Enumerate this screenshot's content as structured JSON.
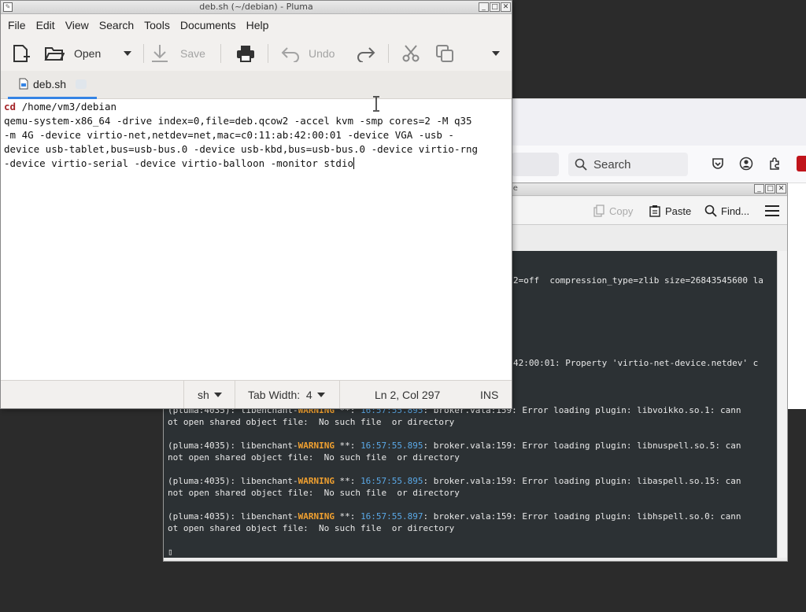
{
  "pluma": {
    "window_title": "deb.sh (~/debian) - Pluma",
    "menu": [
      "File",
      "Edit",
      "View",
      "Search",
      "Tools",
      "Documents",
      "Help"
    ],
    "toolbar": {
      "open_label": "Open",
      "save_label": "Save",
      "undo_label": "Undo"
    },
    "tab": {
      "label": "deb.sh"
    },
    "editor": {
      "line1_keyword": "cd",
      "line1_rest": " /home/vm3/debian",
      "wrapped_lines": [
        "qemu-system-x86_64 -drive index=0,file=deb.qcow2 -accel kvm -smp cores=2 -M q35",
        "-m 4G -device virtio-net,netdev=net,mac=c0:11:ab:42:00:01 -device VGA -usb -",
        "device usb-tablet,bus=usb-bus.0 -device usb-kbd,bus=usb-bus.0 -device virtio-rng",
        "-device virtio-serial -device virtio-balloon -monitor stdio"
      ]
    },
    "status": {
      "language": "sh",
      "tab_width": "Tab Width:  4",
      "position": "Ln 2, Col 297",
      "mode": "INS"
    }
  },
  "browser": {
    "search_placeholder": "Search"
  },
  "terminal": {
    "title_fragment": "le",
    "toolbar": {
      "copy": "Copy",
      "paste": "Paste",
      "find": "Find..."
    },
    "lines_upper": [
      "2=off  compression_type=zlib size=26843545600 la",
      "42:00:01: Property 'virtio-net-device.netdev' c"
    ],
    "warnings": [
      {
        "prefix": "(pluma:4035): libenchant-",
        "level": "WARNING",
        "mid": " **: ",
        "time": "16:57:55.895",
        "msg": ": broker.vala:159: Error loading plugin: libvoikko.so.1: cann",
        "cont": "ot open shared object file:  No such file  or directory"
      },
      {
        "prefix": "(pluma:4035): libenchant-",
        "level": "WARNING",
        "mid": " **: ",
        "time": "16:57:55.895",
        "msg": ": broker.vala:159: Error loading plugin: libnuspell.so.5: can",
        "cont": "not open shared object file:  No such file  or directory"
      },
      {
        "prefix": "(pluma:4035): libenchant-",
        "level": "WARNING",
        "mid": " **: ",
        "time": "16:57:55.895",
        "msg": ": broker.vala:159: Error loading plugin: libaspell.so.15: can",
        "cont": "not open shared object file:  No such file  or directory"
      },
      {
        "prefix": "(pluma:4035): libenchant-",
        "level": "WARNING",
        "mid": " **: ",
        "time": "16:57:55.897",
        "msg": ": broker.vala:159: Error loading plugin: libhspell.so.0: cann",
        "cont": "ot open shared object file:  No such file  or directory"
      }
    ]
  },
  "colors": {
    "accent": "#3584e4",
    "terminal_bg": "#2c3134",
    "warning": "#f0a030",
    "timestamp": "#5aa8e6",
    "keyword": "#a5262a"
  }
}
